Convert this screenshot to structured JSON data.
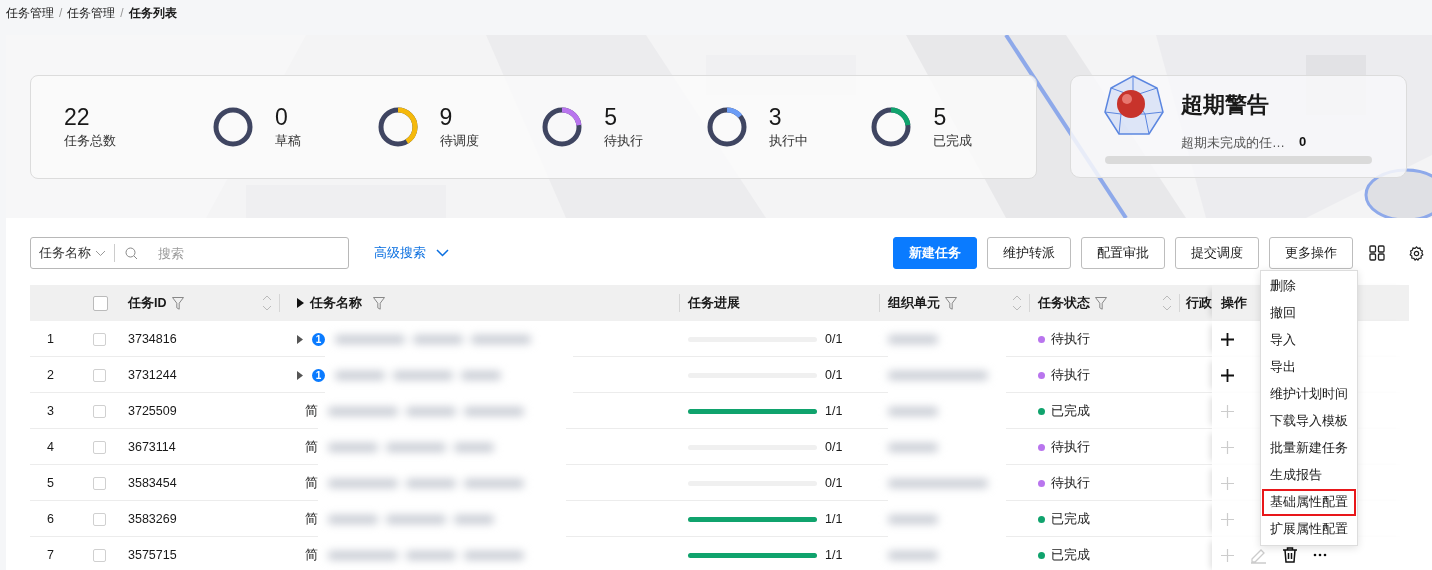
{
  "breadcrumb": [
    {
      "label": "任务管理",
      "current": false
    },
    {
      "separator": "/",
      "label": "任务管理",
      "current": false
    },
    {
      "separator": "/",
      "label": "任务列表",
      "current": true
    }
  ],
  "stats": {
    "items": [
      {
        "kind": "total",
        "value": "22",
        "label": "任务总数"
      },
      {
        "kind": "ring",
        "value": "0",
        "label": "草稿"
      },
      {
        "kind": "ring",
        "value": "9",
        "label": "待调度",
        "level": 0.41,
        "color": "#f5b90b"
      },
      {
        "kind": "ring",
        "value": "5",
        "label": "待执行",
        "level": 0.23,
        "color": "#b975ee"
      },
      {
        "kind": "ring",
        "value": "3",
        "label": "执行中",
        "level": 0.14,
        "color": "#6b9cf6"
      },
      {
        "kind": "ring",
        "value": "5",
        "label": "已完成",
        "level": 0.23,
        "color": "#10a36d"
      }
    ]
  },
  "alert": {
    "title": "超期警告",
    "label": "超期未完成的任…",
    "count": "0",
    "level": 0
  },
  "toolbar": {
    "search_scope": "任务名称",
    "placeholder": "搜索",
    "advanced": "高级搜索",
    "buttons": [
      {
        "label": "新建任务",
        "kind": "primary"
      },
      {
        "label": "维护转派",
        "kind": "default"
      },
      {
        "label": "配置审批",
        "kind": "default"
      },
      {
        "label": "提交调度",
        "kind": "default"
      },
      {
        "label": "更多操作",
        "kind": "menu"
      }
    ]
  },
  "more_menu": {
    "items": [
      {
        "label": "删除",
        "highlighted": false
      },
      {
        "label": "撤回",
        "highlighted": false
      },
      {
        "label": "导入",
        "highlighted": false
      },
      {
        "label": "导出",
        "highlighted": false
      },
      {
        "label": "维护计划时间",
        "highlighted": false
      },
      {
        "label": "下载导入模板",
        "highlighted": false
      },
      {
        "label": "批量新建任务",
        "highlighted": false
      },
      {
        "label": "生成报告",
        "highlighted": false
      },
      {
        "label": "基础属性配置",
        "highlighted": true
      },
      {
        "label": "扩展属性配置",
        "highlighted": false
      }
    ]
  },
  "table": {
    "select_all": {
      "checked": false
    },
    "columns": [
      {
        "label": "任务ID",
        "filter": true,
        "sort": true
      },
      {
        "label": "任务名称",
        "filter": true,
        "sort": false,
        "expander": true
      },
      {
        "label": "任务进展",
        "filter": false,
        "sort": false
      },
      {
        "label": "组织单元",
        "filter": true,
        "sort": true
      },
      {
        "label": "任务状态",
        "filter": true,
        "sort": true
      },
      {
        "label": "行政",
        "filter": false,
        "sort": false
      },
      {
        "label": "操作",
        "filter": false,
        "sort": false
      }
    ],
    "rows": [
      {
        "index": "1",
        "checked": false,
        "id": "3734816",
        "expandable": true,
        "badge": "1",
        "progress": {
          "level": 0,
          "text": "0/1"
        },
        "status": {
          "label": "待执行",
          "color": "#b975ee"
        },
        "actions": [
          {
            "kind": "add",
            "enabled": true
          }
        ]
      },
      {
        "index": "2",
        "checked": false,
        "id": "3731244",
        "expandable": true,
        "badge": "1",
        "progress": {
          "level": 0,
          "text": "0/1"
        },
        "status": {
          "label": "待执行",
          "color": "#b975ee"
        },
        "actions": [
          {
            "kind": "add",
            "enabled": true
          }
        ]
      },
      {
        "index": "3",
        "checked": false,
        "id": "3725509",
        "expandable": false,
        "name": "简",
        "progress": {
          "level": 1,
          "text": "1/1"
        },
        "status": {
          "label": "已完成",
          "color": "#10a36d"
        },
        "actions": [
          {
            "kind": "add",
            "enabled": false
          }
        ]
      },
      {
        "index": "4",
        "checked": false,
        "id": "3673114",
        "expandable": false,
        "name": "简",
        "progress": {
          "level": 0,
          "text": "0/1"
        },
        "status": {
          "label": "待执行",
          "color": "#b975ee"
        },
        "actions": [
          {
            "kind": "add",
            "enabled": false
          }
        ]
      },
      {
        "index": "5",
        "checked": false,
        "id": "3583454",
        "expandable": false,
        "name": "简",
        "progress": {
          "level": 0,
          "text": "0/1"
        },
        "status": {
          "label": "待执行",
          "color": "#b975ee"
        },
        "actions": [
          {
            "kind": "add",
            "enabled": false
          }
        ]
      },
      {
        "index": "6",
        "checked": false,
        "id": "3583269",
        "expandable": false,
        "name": "简",
        "progress": {
          "level": 1,
          "text": "1/1"
        },
        "status": {
          "label": "已完成",
          "color": "#10a36d"
        },
        "actions": [
          {
            "kind": "add",
            "enabled": false
          }
        ]
      },
      {
        "index": "7",
        "checked": false,
        "id": "3575715",
        "expandable": false,
        "name": "简",
        "progress": {
          "level": 1,
          "text": "1/1"
        },
        "status": {
          "label": "已完成",
          "color": "#10a36d"
        },
        "actions": [
          {
            "kind": "add",
            "enabled": false
          },
          {
            "kind": "edit",
            "enabled": false
          },
          {
            "kind": "delete",
            "enabled": true
          },
          {
            "kind": "more",
            "enabled": true
          }
        ]
      }
    ]
  }
}
